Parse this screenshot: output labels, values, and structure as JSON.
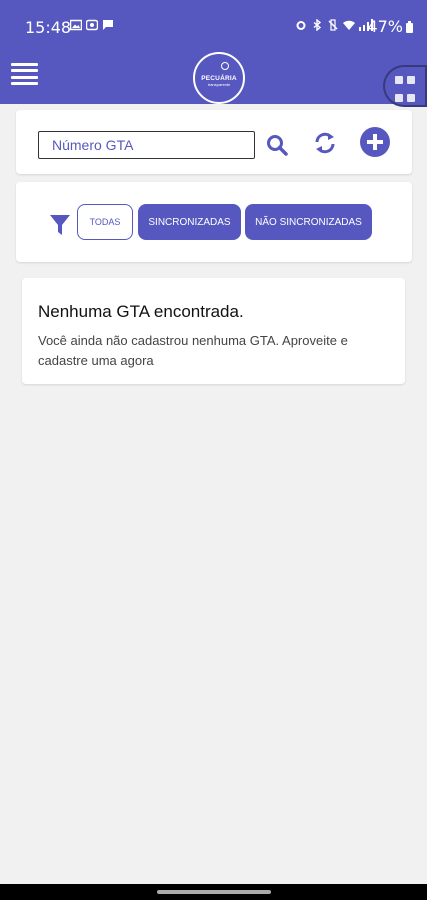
{
  "status_bar": {
    "time": "15:48",
    "battery": "47%"
  },
  "app": {
    "logo_text": "PECUÁRIA",
    "logo_subtext": "transparente",
    "brand_color": "#5658c0"
  },
  "search": {
    "placeholder": "Número GTA",
    "value": ""
  },
  "filters": {
    "all_label": "TODAS",
    "synced_label": "SINCRONIZADAS",
    "unsynced_label": "NÃO SINCRONIZADAS",
    "selected": "TODAS"
  },
  "empty_state": {
    "title": "Nenhuma GTA encontrada.",
    "description": "Você ainda não cadastrou nenhuma GTA. Aproveite e cadastre uma agora"
  },
  "icons": {
    "menu": "menu-icon",
    "apps": "apps-grid-icon",
    "search": "search-icon",
    "sync": "sync-icon",
    "add": "add-circle-icon",
    "filter": "filter-icon"
  }
}
